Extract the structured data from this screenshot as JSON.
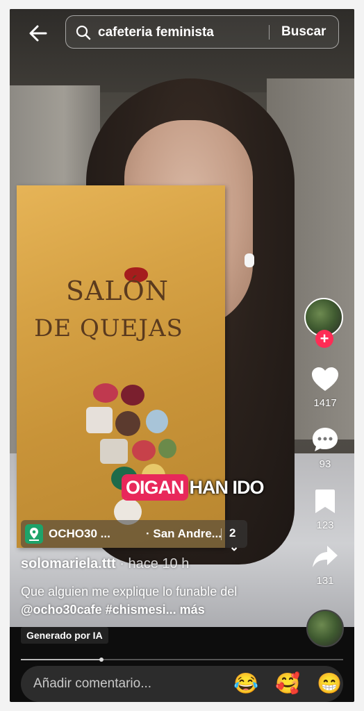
{
  "search": {
    "query": "cafeteria feminista",
    "button_label": "Buscar"
  },
  "video": {
    "box_text_line1": "SALÓN",
    "box_text_line2": "DE QUEJAS",
    "caption_highlight": "OIGAN",
    "caption_rest": "HAN IDO"
  },
  "rail": {
    "likes": "1417",
    "comments": "93",
    "saves": "123",
    "shares": "131"
  },
  "location": {
    "name": "OCHO30 ...",
    "city": "· San Andre...",
    "count": "2"
  },
  "post": {
    "username": "solomariela.ttt",
    "time": " · hace 10 h",
    "description_prefix": "Que alguien me explique lo funable del ",
    "mention": "@ocho30cafe",
    "hashtag": " #chismesi...",
    "more": " más"
  },
  "ai_label": "Generado por IA",
  "progress": 0.25,
  "comment": {
    "placeholder": "Añadir comentario...",
    "emojis": [
      "😂",
      "🥰",
      "😁"
    ]
  },
  "colors": {
    "accent_red": "#fe2c55",
    "caption_highlight": "#e8285a",
    "location_green": "#1ea36a"
  }
}
